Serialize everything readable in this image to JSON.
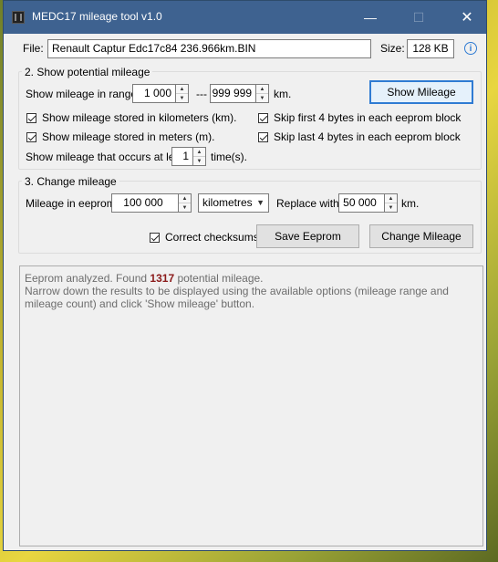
{
  "window": {
    "title": "MEDC17 mileage tool  v1.0",
    "minimize": "—",
    "maximize": "☐",
    "close": "✕"
  },
  "file": {
    "label": "File:",
    "value": "Renault Captur Edc17c84  236.966km.BIN",
    "size_label": "Size:",
    "size_value": "128 KB",
    "info_icon": "i"
  },
  "show_group": {
    "title": "2. Show potential mileage",
    "range_label": "Show mileage in range:",
    "range_from": "1 000",
    "range_sep": "---",
    "range_to": "999 999",
    "range_unit": "km.",
    "show_button": "Show Mileage",
    "chk_km": "Show mileage stored in kilometers (km).",
    "chk_m": "Show mileage stored in meters (m).",
    "chk_skip_first": "Skip first 4 bytes in each eeprom block",
    "chk_skip_last": "Skip last 4 bytes in each eeprom block",
    "occurs_label": "Show mileage that occurs at least",
    "occurs_value": "1",
    "occurs_unit": "time(s)."
  },
  "change_group": {
    "title": "3. Change mileage",
    "eeprom_label": "Mileage in eeprom:",
    "eeprom_value": "100 000",
    "unit_select": "kilometres",
    "replace_label": "Replace with",
    "replace_value": "50 000",
    "replace_unit": "km.",
    "chk_checksums": "Correct checksums",
    "save_button": "Save Eeprom",
    "change_button": "Change Mileage"
  },
  "log": {
    "line1_prefix": "Eeprom analyzed. Found ",
    "count": "1317",
    "line1_suffix": " potential mileage.",
    "line2": "Narrow down the results to be displayed using the available options (mileage range and mileage count) and click 'Show mileage' button."
  }
}
